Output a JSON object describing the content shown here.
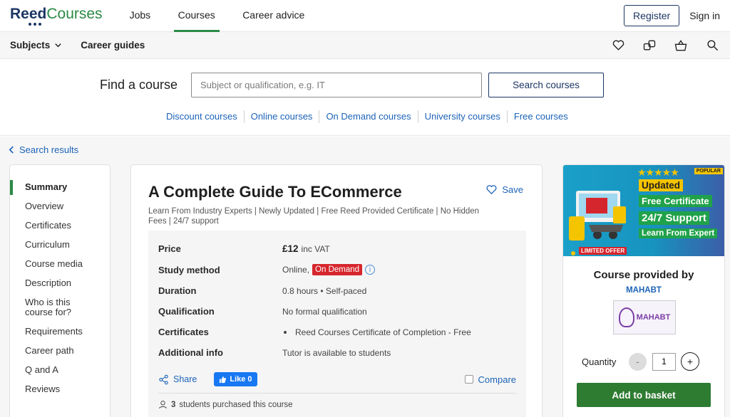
{
  "brand": {
    "name_part1": "Reed",
    "name_part2": "Courses"
  },
  "topnav": [
    {
      "label": "Jobs",
      "active": false
    },
    {
      "label": "Courses",
      "active": true
    },
    {
      "label": "Career advice",
      "active": false
    }
  ],
  "auth": {
    "register": "Register",
    "signin": "Sign in"
  },
  "subbar": {
    "subjects": "Subjects",
    "career_guides": "Career guides",
    "icons": [
      "heart-icon",
      "compare-icon",
      "basket-icon",
      "search-icon"
    ]
  },
  "search": {
    "title": "Find a course",
    "placeholder": "Subject or qualification, e.g. IT",
    "button": "Search courses",
    "quicklinks": [
      "Discount courses",
      "Online courses",
      "On Demand courses",
      "University courses",
      "Free courses"
    ]
  },
  "back": "Search results",
  "sidenav": [
    "Summary",
    "Overview",
    "Certificates",
    "Curriculum",
    "Course media",
    "Description",
    "Who is this course for?",
    "Requirements",
    "Career path",
    "Q and A",
    "Reviews"
  ],
  "course": {
    "title": "A Complete Guide To ECommerce",
    "save": "Save",
    "subtitle": "Learn From Industry Experts | Newly Updated | Free Reed Provided Certificate | No Hidden Fees | 24/7 support",
    "details": {
      "price_label": "Price",
      "price": "£12",
      "price_suffix": "inc VAT",
      "study_label": "Study method",
      "study_value": "Online,",
      "study_badge": "On Demand",
      "duration_label": "Duration",
      "duration_value": "0.8 hours • Self-paced",
      "qualification_label": "Qualification",
      "qualification_value": "No formal qualification",
      "certificates_label": "Certificates",
      "certificates_value": "Reed Courses Certificate of Completion - Free",
      "additional_label": "Additional info",
      "additional_value": "Tutor is available to students"
    },
    "share": "Share",
    "like": "Like 0",
    "compare": "Compare",
    "purchased_count": "3",
    "purchased_text": "students purchased this course"
  },
  "provider": {
    "banner": {
      "popular": "POPULAR",
      "line1": "Updated",
      "line2": "Free Certificate",
      "line3": "24/7 Support",
      "line4": "Learn From Expert",
      "limited": "LIMITED OFFER"
    },
    "provided_by": "Course provided by",
    "name": "MAHABT",
    "logo_text": "MAHABT",
    "quantity_label": "Quantity",
    "quantity_value": "1",
    "minus": "-",
    "plus": "+",
    "add_to_basket": "Add to basket"
  }
}
